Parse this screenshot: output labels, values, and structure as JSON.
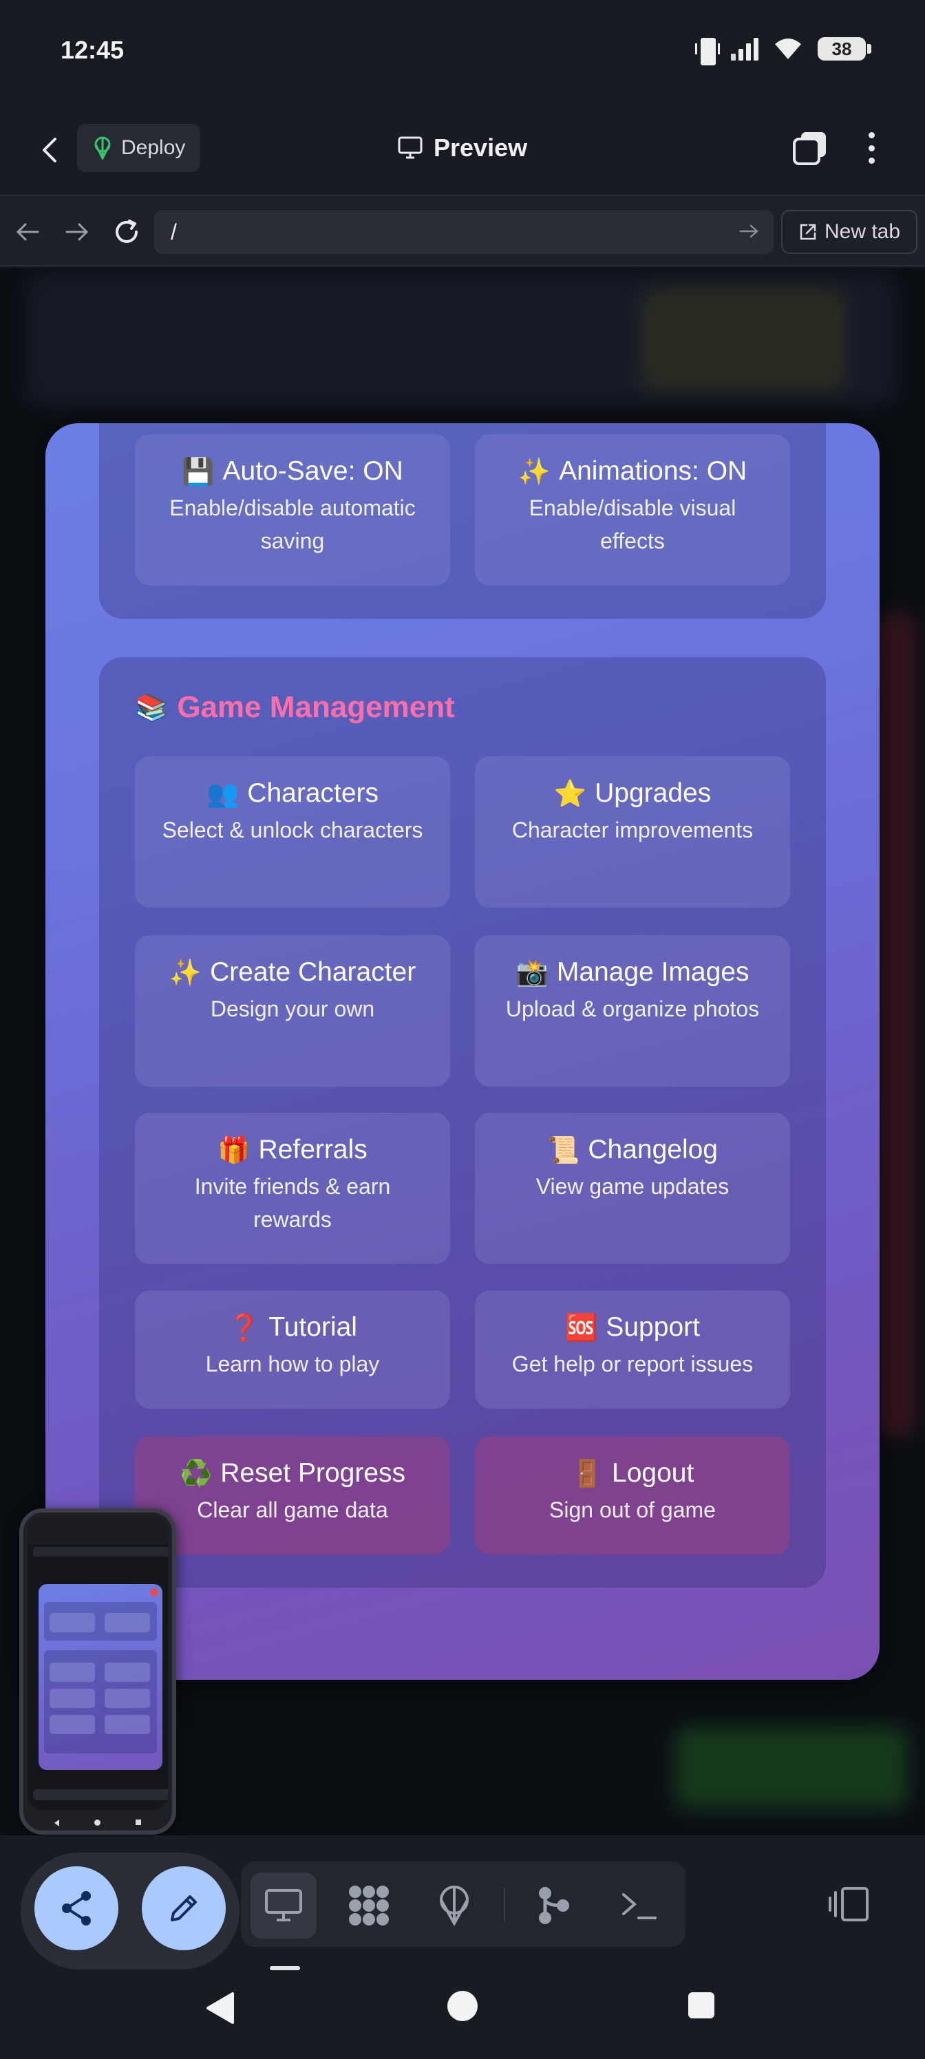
{
  "status_bar": {
    "time": "12:45",
    "battery": "38",
    "icons": [
      "vibrate-icon",
      "signal-icon",
      "wifi-icon",
      "battery-icon"
    ]
  },
  "header": {
    "deploy_label": "Deploy",
    "title": "Preview"
  },
  "browser": {
    "url": "/",
    "new_tab_label": "New tab"
  },
  "settings_section": {
    "cards": [
      {
        "emoji": "💾",
        "title": "Auto-Save: ON",
        "desc": "Enable/disable automatic saving"
      },
      {
        "emoji": "✨",
        "title": "Animations: ON",
        "desc": "Enable/disable visual effects"
      }
    ]
  },
  "game_management": {
    "emoji": "📚",
    "title": "Game Management",
    "cards": [
      {
        "emoji": "👥",
        "title": "Characters",
        "desc": "Select & unlock characters"
      },
      {
        "emoji": "⭐",
        "title": "Upgrades",
        "desc": "Character improvements"
      },
      {
        "emoji": "✨",
        "title": "Create Character",
        "desc": "Design your own"
      },
      {
        "emoji": "📸",
        "title": "Manage Images",
        "desc": "Upload & organize photos"
      },
      {
        "emoji": "🎁",
        "title": "Referrals",
        "desc": "Invite friends & earn rewards"
      },
      {
        "emoji": "📜",
        "title": "Changelog",
        "desc": "View game updates"
      },
      {
        "emoji": "❓",
        "title": "Tutorial",
        "desc": "Learn how to play"
      },
      {
        "emoji": "🆘",
        "title": "Support",
        "desc": "Get help or report issues"
      },
      {
        "emoji": "♻️",
        "title": "Reset Progress",
        "desc": "Clear all game data"
      },
      {
        "emoji": "🚪",
        "title": "Logout",
        "desc": "Sign out of game"
      }
    ]
  },
  "colors": {
    "section_title": "#ff6ea8",
    "fab": "#a9c9ff",
    "background": "#191b22"
  }
}
